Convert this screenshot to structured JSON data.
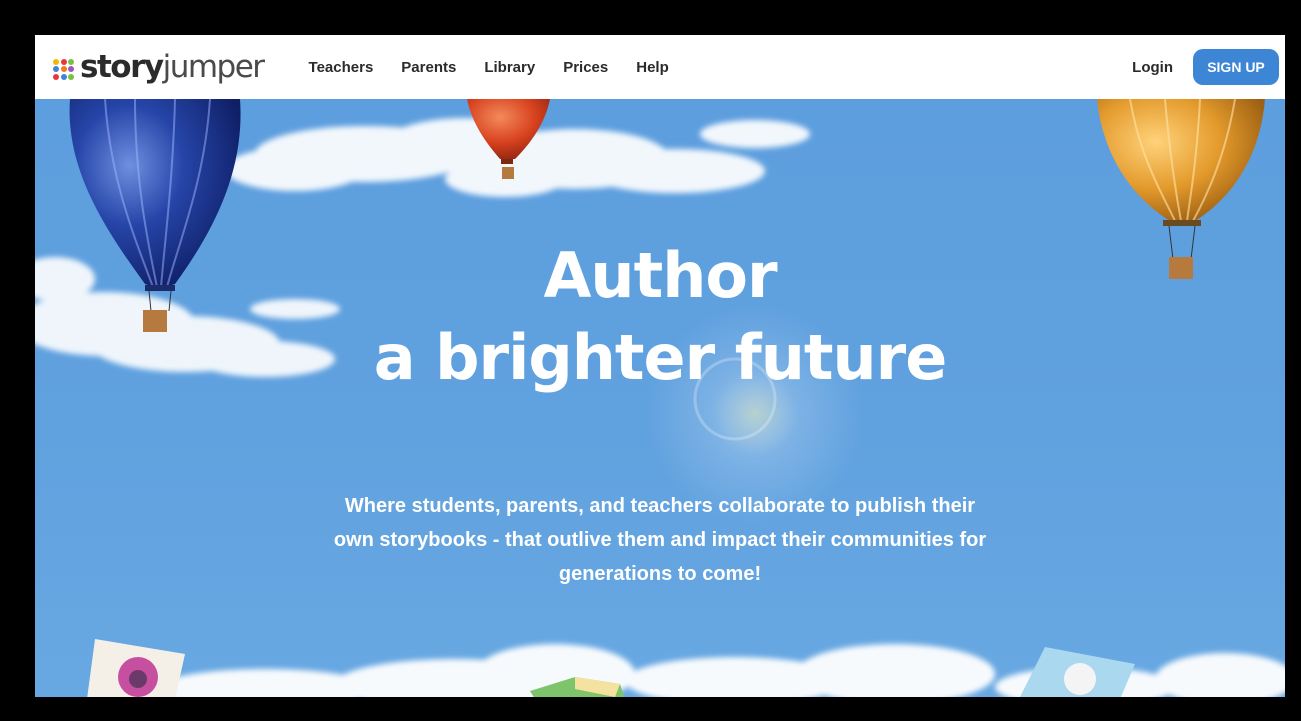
{
  "brand": {
    "logo_story": "story",
    "logo_jumper": "jumper",
    "dot_colors": [
      "#f5b800",
      "#e8383d",
      "#7ac143",
      "#3d86d6",
      "#f27a1a",
      "#9b59b6",
      "#e8383d",
      "#3d86d6",
      "#7ac143"
    ]
  },
  "nav": {
    "links": [
      {
        "label": "Teachers"
      },
      {
        "label": "Parents"
      },
      {
        "label": "Library"
      },
      {
        "label": "Prices"
      },
      {
        "label": "Help"
      }
    ],
    "login_label": "Login",
    "signup_label": "SIGN UP"
  },
  "hero": {
    "headline_line1": "Author",
    "headline_line2": "a brighter future",
    "subtitle": "Where students, parents, and teachers collaborate to publish their own storybooks - that outlive them and impact their communities for generations to come!"
  },
  "colors": {
    "sky": "#5e9fdc",
    "accent": "#3d86d6",
    "balloon_blue": "#1e3fa0",
    "balloon_red": "#e0502a",
    "balloon_gold": "#e0a030"
  }
}
